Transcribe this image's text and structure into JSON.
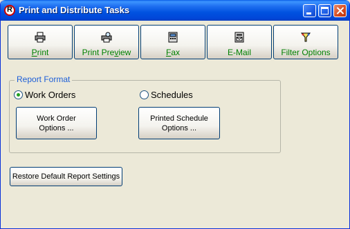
{
  "window": {
    "title": "Print and Distribute Tasks",
    "app_icon_letter": "R"
  },
  "toolbar": {
    "buttons": [
      {
        "label_pre": "",
        "label_key": "P",
        "label_post": "rint",
        "icon": "printer-icon"
      },
      {
        "label_pre": "Print Pre",
        "label_key": "v",
        "label_post": "iew",
        "icon": "print-preview-icon"
      },
      {
        "label_pre": "",
        "label_key": "F",
        "label_post": "ax",
        "icon": "fax-icon"
      },
      {
        "label_pre": "E-Mail",
        "label_key": "",
        "label_post": "",
        "icon": "email-icon"
      },
      {
        "label_pre": "Filter Options",
        "label_key": "",
        "label_post": "",
        "icon": "filter-icon"
      }
    ]
  },
  "report_format": {
    "legend": "Report Format",
    "work_orders_label": "Work Orders",
    "work_orders_selected": true,
    "schedules_label": "Schedules",
    "schedules_selected": false,
    "work_order_options_line1": "Work Order",
    "work_order_options_line2": "Options ...",
    "schedule_options_line1": "Printed Schedule",
    "schedule_options_line2": "Options ..."
  },
  "restore_button_label": "Restore Default Report Settings",
  "colors": {
    "title_bar": "#0052e0",
    "toolbar_label": "#008000",
    "group_legend": "#1c5ed8",
    "radio_dot": "#21a121"
  }
}
